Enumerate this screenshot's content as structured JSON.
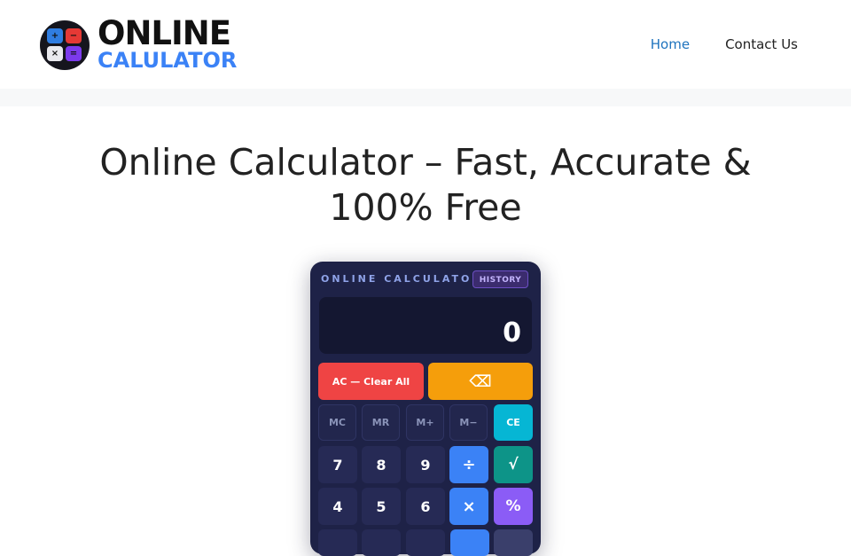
{
  "header": {
    "logo": {
      "line1": "ONLINE",
      "line2": "CALULATOR",
      "badge_symbols": [
        "+",
        "−",
        "×",
        "="
      ]
    },
    "nav": [
      {
        "label": "Home",
        "active": true
      },
      {
        "label": "Contact Us",
        "active": false
      }
    ]
  },
  "main": {
    "title": "Online Calculator – Fast, Accurate & 100% Free"
  },
  "calculator": {
    "brand": "ONLINE CALCULATOR",
    "history_label": "HISTORY",
    "display_value": "0",
    "clear_all_label": "AC — Clear All",
    "backspace_label": "⌫",
    "memory": [
      "MC",
      "MR",
      "M+",
      "M−"
    ],
    "ce_label": "CE",
    "row1": [
      "7",
      "8",
      "9",
      "÷",
      "√"
    ],
    "row2": [
      "4",
      "5",
      "6",
      "×",
      "%"
    ],
    "colors": {
      "body": "#1e2247",
      "clear": "#ef4444",
      "backspace": "#f59e0b",
      "ce": "#06b6d4",
      "operator": "#3b82f6",
      "sqrt": "#0d9488",
      "percent": "#8b5cf6"
    }
  }
}
